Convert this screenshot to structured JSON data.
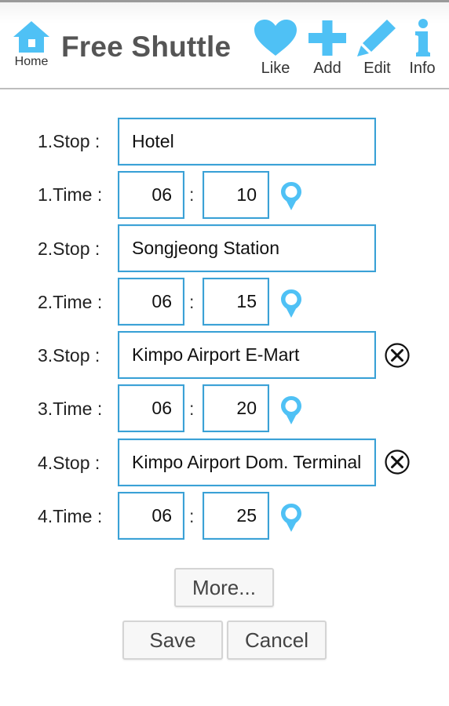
{
  "header": {
    "home_label": "Home",
    "title": "Free Shuttle",
    "actions": [
      {
        "label": "Like",
        "icon": "heart-icon"
      },
      {
        "label": "Add",
        "icon": "plus-icon"
      },
      {
        "label": "Edit",
        "icon": "pencil-icon"
      },
      {
        "label": "Info",
        "icon": "info-icon"
      }
    ],
    "accent_color": "#4fc1f5"
  },
  "form": {
    "colon": ":",
    "stops": [
      {
        "stop_label": "1.Stop :",
        "stop_value": "Hotel",
        "time_label": "1.Time :",
        "hour": "06",
        "minute": "10",
        "removable": false
      },
      {
        "stop_label": "2.Stop :",
        "stop_value": "Songjeong Station",
        "time_label": "2.Time :",
        "hour": "06",
        "minute": "15",
        "removable": false
      },
      {
        "stop_label": "3.Stop :",
        "stop_value": "Kimpo Airport E-Mart",
        "time_label": "3.Time :",
        "hour": "06",
        "minute": "20",
        "removable": true
      },
      {
        "stop_label": "4.Stop :",
        "stop_value": "Kimpo Airport Dom. Terminal",
        "time_label": "4.Time :",
        "hour": "06",
        "minute": "25",
        "removable": true
      }
    ],
    "field_border_color": "#3aa1d6"
  },
  "buttons": {
    "more": "More...",
    "save": "Save",
    "cancel": "Cancel"
  }
}
